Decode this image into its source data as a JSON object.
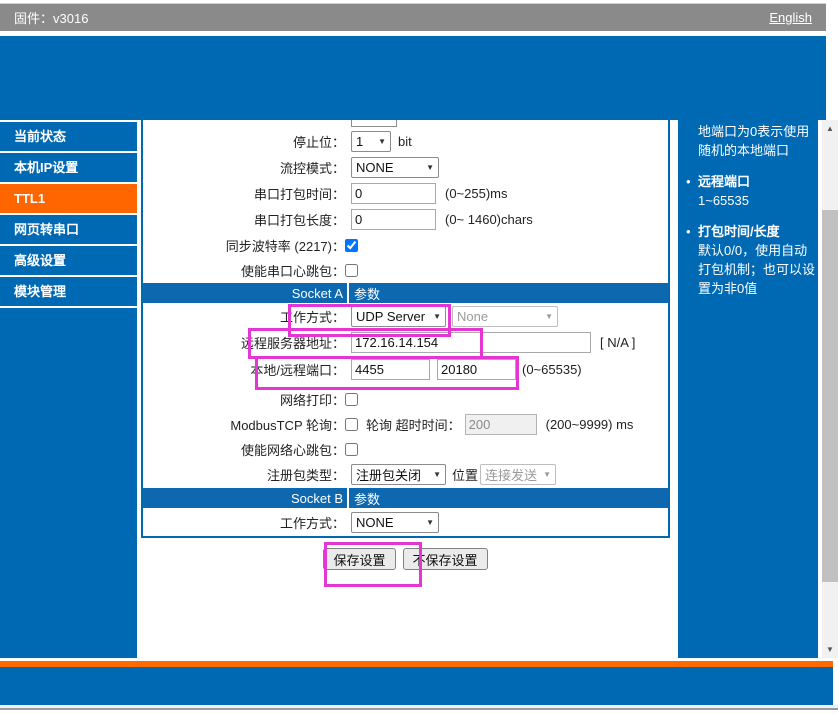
{
  "topbar": {
    "firmware_label": "固件：v3016",
    "english_link": "English"
  },
  "sidebar": {
    "items": [
      {
        "label": "当前状态"
      },
      {
        "label": "本机IP设置"
      },
      {
        "label": "TTL1"
      },
      {
        "label": "网页转串口"
      },
      {
        "label": "高级设置"
      },
      {
        "label": "模块管理"
      }
    ],
    "active_index": 2
  },
  "form": {
    "stop_bits": {
      "label": "停止位：",
      "value": "1",
      "unit": "bit"
    },
    "flow_control": {
      "label": "流控模式：",
      "value": "NONE"
    },
    "pack_time": {
      "label": "串口打包时间：",
      "value": "0",
      "hint": "(0~255)ms"
    },
    "pack_length": {
      "label": "串口打包长度：",
      "value": "0",
      "hint": "(0~ 1460)chars"
    },
    "sync_baud": {
      "label": "同步波特率 (2217)：",
      "checked": true
    },
    "serial_heartbeat": {
      "label": "使能串口心跳包：",
      "checked": false
    },
    "socket_a": {
      "title": "Socket A",
      "subtitle": "参数"
    },
    "work_mode_a": {
      "label": "工作方式：",
      "value": "UDP Server",
      "value2": "None"
    },
    "remote_server": {
      "label": "远程服务器地址：",
      "value": "172.16.14.154",
      "hint": "[ N/A ]"
    },
    "ports": {
      "label": "本地/远程端口：",
      "local": "4455",
      "remote": "20180",
      "hint": "(0~65535)"
    },
    "net_print": {
      "label": "网络打印：",
      "checked": false
    },
    "modbus": {
      "label": "ModbusTCP 轮询：",
      "checked": false,
      "sub_label": "轮询 超时时间：",
      "value": "200",
      "hint": "(200~9999) ms"
    },
    "net_heartbeat": {
      "label": "使能网络心跳包：",
      "checked": false
    },
    "reg_packet": {
      "label": "注册包类型：",
      "value": "注册包关闭",
      "pos_label": "位置",
      "pos_value": "连接发送"
    },
    "socket_b": {
      "title": "Socket B",
      "subtitle": "参数"
    },
    "work_mode_b": {
      "label": "工作方式：",
      "value": "NONE"
    },
    "save_button": "保存设置",
    "discard_button": "不保存设置"
  },
  "help": {
    "continuation": [
      "地端口为0表示使用",
      "随机的本地端口"
    ],
    "items": [
      {
        "title": "远程端口",
        "lines": [
          "1~65535"
        ]
      },
      {
        "title": "打包时间/长度",
        "lines": [
          "默认0/0，使用自动",
          "打包机制；也可以设",
          "置为非0值"
        ]
      }
    ]
  },
  "icons": {
    "select_arrow": "▼",
    "up_arrow": "▲",
    "down_arrow": "▼",
    "bullet": "•"
  },
  "colors": {
    "accent_blue": "#0069b4",
    "active_orange": "#ff6600",
    "divider_orange": "#ff6a00",
    "highlight_magenta": "#e535d2",
    "topbar_gray": "#8a8a8a"
  }
}
